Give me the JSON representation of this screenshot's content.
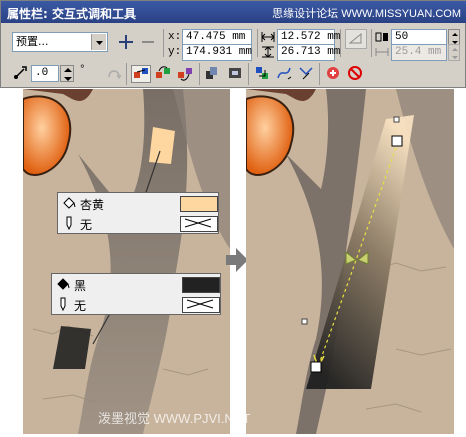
{
  "window": {
    "title": "属性栏: 交互式调和工具",
    "watermark": "思缘设计论坛 WWW.MISSYUAN.COM"
  },
  "toolbar": {
    "preset_select": "预置...",
    "pos_x_label": "x:",
    "pos_x_value": "47.475 mm",
    "pos_y_label": "y:",
    "pos_y_value": "174.931 mm",
    "width_value": "12.572 mm",
    "height_value": "26.713 mm",
    "steps_value": "50",
    "spacing_value": "25.4 mm",
    "angle_value": ".0",
    "degree_symbol": "°",
    "icons": [
      "add-preset-icon",
      "remove-preset-icon",
      "width-arrow-icon",
      "height-arrow-icon",
      "steps-icon",
      "spacing-icon",
      "blend-direction-icon",
      "loop-blend-icon",
      "direct-blend-icon",
      "clockwise-blend-icon",
      "counterclockwise-blend-icon",
      "object-acceleration-icon",
      "color-acceleration-icon",
      "end-properties-icon",
      "path-properties-icon",
      "more-options-icon",
      "copy-blend-icon",
      "clear-blend-icon"
    ]
  },
  "left_popup_1": {
    "fill_label": "杏黄",
    "outline_label": "无",
    "fill_color": "#fdd6a0"
  },
  "left_popup_2": {
    "fill_label": "黑",
    "outline_label": "无",
    "fill_color": "#222222"
  },
  "bottom_watermark": "泼墨视觉 WWW.PJVI.NET",
  "colors": {
    "canvas_bg": "#c8b49c",
    "toolbar_bg": "#d4d0c8",
    "title_bg": "#2a4184",
    "blend_arrow": "#e8e040"
  }
}
